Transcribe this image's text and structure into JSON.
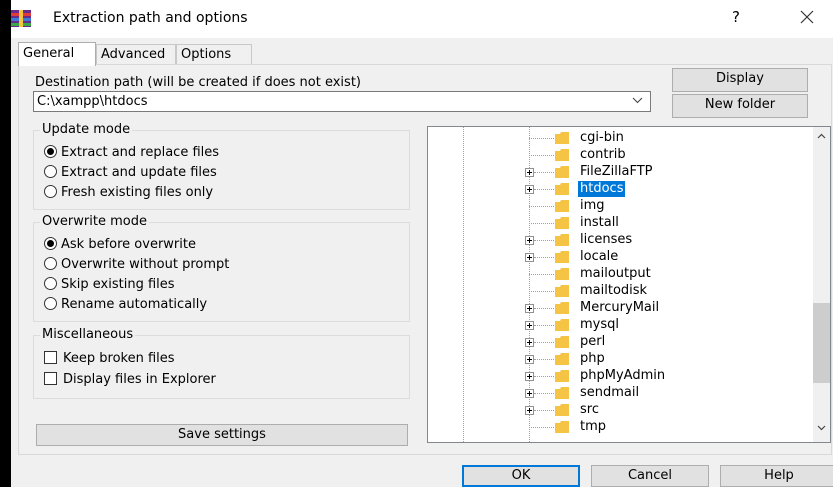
{
  "window": {
    "title": "Extraction path and options",
    "help_glyph": "?",
    "close_glyph": "✕"
  },
  "tabs": [
    {
      "label": "General"
    },
    {
      "label": "Advanced"
    },
    {
      "label": "Options"
    }
  ],
  "destination": {
    "label": "Destination path (will be created if does not exist)",
    "value": "C:\\xampp\\htdocs"
  },
  "buttons": {
    "display": "Display",
    "new_folder": "New folder",
    "save_settings": "Save settings",
    "ok": "OK",
    "cancel": "Cancel",
    "help": "Help"
  },
  "update_mode": {
    "title": "Update mode",
    "options": [
      {
        "label": "Extract and replace files",
        "selected": true
      },
      {
        "label": "Extract and update files",
        "selected": false
      },
      {
        "label": "Fresh existing files only",
        "selected": false
      }
    ]
  },
  "overwrite_mode": {
    "title": "Overwrite mode",
    "options": [
      {
        "label": "Ask before overwrite",
        "selected": true
      },
      {
        "label": "Overwrite without prompt",
        "selected": false
      },
      {
        "label": "Skip existing files",
        "selected": false
      },
      {
        "label": "Rename automatically",
        "selected": false
      }
    ]
  },
  "misc": {
    "title": "Miscellaneous",
    "options": [
      {
        "label": "Keep broken files",
        "checked": false
      },
      {
        "label": "Display files in Explorer",
        "checked": false
      }
    ]
  },
  "tree": {
    "items": [
      {
        "label": "cgi-bin",
        "expandable": false,
        "selected": false
      },
      {
        "label": "contrib",
        "expandable": false,
        "selected": false
      },
      {
        "label": "FileZillaFTP",
        "expandable": true,
        "selected": false
      },
      {
        "label": "htdocs",
        "expandable": true,
        "selected": true
      },
      {
        "label": "img",
        "expandable": false,
        "selected": false
      },
      {
        "label": "install",
        "expandable": false,
        "selected": false
      },
      {
        "label": "licenses",
        "expandable": true,
        "selected": false
      },
      {
        "label": "locale",
        "expandable": true,
        "selected": false
      },
      {
        "label": "mailoutput",
        "expandable": false,
        "selected": false
      },
      {
        "label": "mailtodisk",
        "expandable": false,
        "selected": false
      },
      {
        "label": "MercuryMail",
        "expandable": true,
        "selected": false
      },
      {
        "label": "mysql",
        "expandable": true,
        "selected": false
      },
      {
        "label": "perl",
        "expandable": true,
        "selected": false
      },
      {
        "label": "php",
        "expandable": true,
        "selected": false
      },
      {
        "label": "phpMyAdmin",
        "expandable": true,
        "selected": false
      },
      {
        "label": "sendmail",
        "expandable": true,
        "selected": false
      },
      {
        "label": "src",
        "expandable": true,
        "selected": false
      },
      {
        "label": "tmp",
        "expandable": false,
        "selected": false
      }
    ]
  },
  "colors": {
    "selection": "#0078d7",
    "folder": "#f6c445",
    "dialog_bg": "#f0f0f0"
  }
}
